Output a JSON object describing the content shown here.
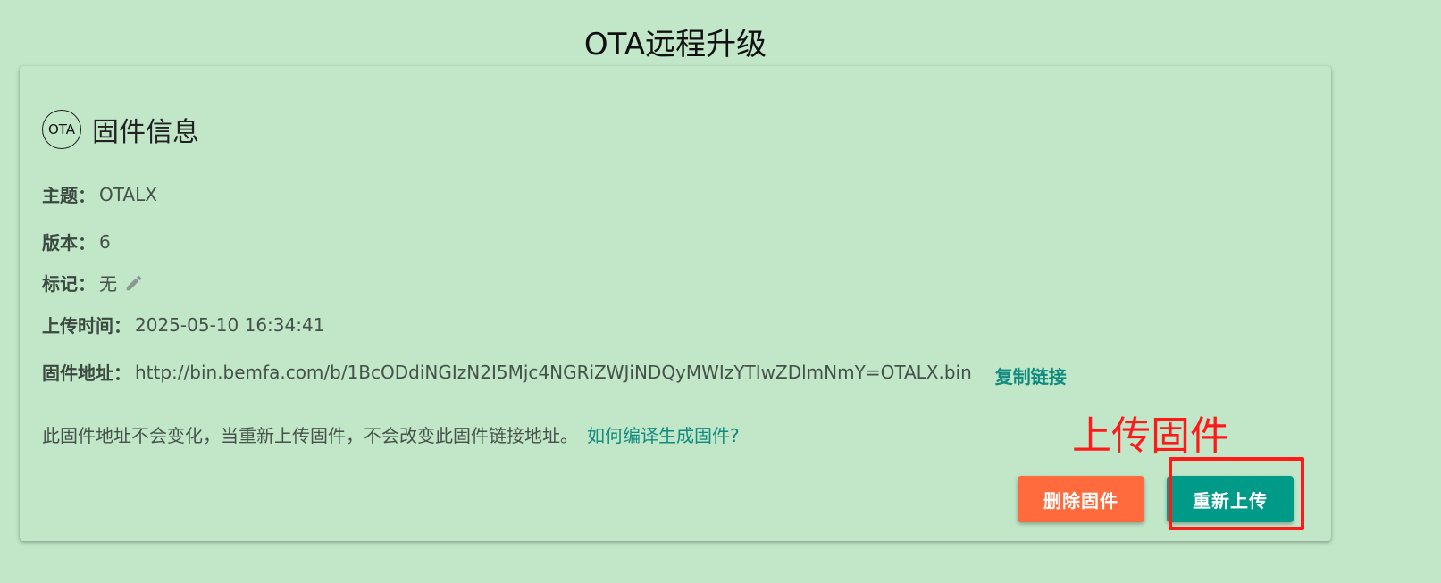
{
  "page": {
    "title": "OTA远程升级"
  },
  "card": {
    "badge": "OTA",
    "title": "固件信息",
    "fields": {
      "topic_label": "主题：",
      "topic_value": "OTALX",
      "version_label": "版本：",
      "version_value": "6",
      "tag_label": "标记：",
      "tag_value": "无",
      "upload_time_label": "上传时间：",
      "upload_time_value": "2025-05-10 16:34:41",
      "address_label": "固件地址：",
      "address_value": "http://bin.bemfa.com/b/1BcODdiNGIzN2I5Mjc4NGRiZWJiNDQyMWIzYTIwZDlmNmY=OTALX.bin"
    },
    "copy_link": "复制链接",
    "note": "此固件地址不会变化，当重新上传固件，不会改变此固件链接地址。",
    "help_link": "如何编译生成固件?",
    "buttons": {
      "delete": "删除固件",
      "reupload": "重新上传"
    }
  },
  "annotation": {
    "text": "上传固件"
  },
  "icons": {
    "edit": "pencil-icon"
  },
  "colors": {
    "background": "#c1e6c8",
    "teal": "#0f8a7e",
    "delete_button": "#ff6b3d",
    "reupload_button": "#009a88",
    "annotation": "#ff1a1a"
  }
}
